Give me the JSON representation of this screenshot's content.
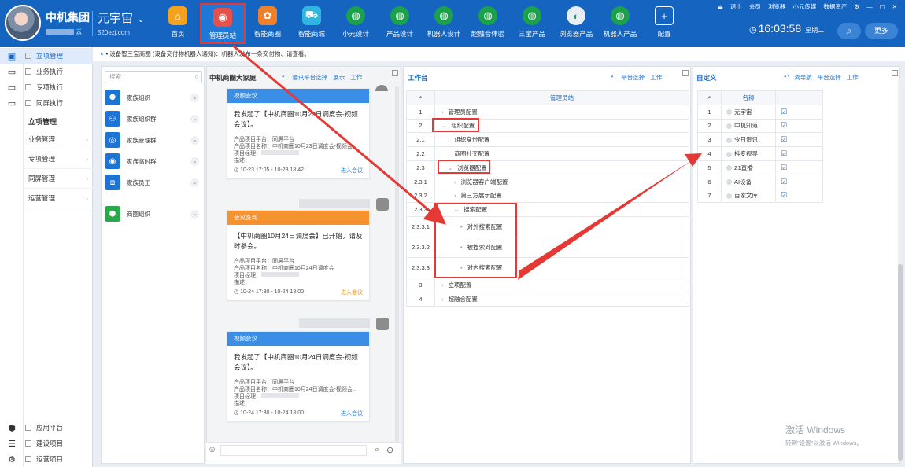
{
  "header": {
    "company": "中机集团",
    "company_sub": "云",
    "universe": "元宇宙",
    "universe_url": "520ezj.com",
    "nav": [
      {
        "label": "首页",
        "icon": "home-icon",
        "color": "#f4a11e",
        "active": false
      },
      {
        "label": "管理员站",
        "icon": "admin-icon",
        "color": "#e8504a",
        "active": true
      },
      {
        "label": "智能商圈",
        "icon": "business-circle-icon",
        "color": "#f0802c",
        "active": false
      },
      {
        "label": "智能商城",
        "icon": "cart-icon",
        "color": "#2fb6e0",
        "active": false
      },
      {
        "label": "小元设计",
        "icon": "globe-icon",
        "color": "#1aa14a",
        "active": false
      },
      {
        "label": "产品设计",
        "icon": "globe-icon",
        "color": "#1aa14a",
        "active": false
      },
      {
        "label": "机器人设计",
        "icon": "globe-icon",
        "color": "#1aa14a",
        "active": false
      },
      {
        "label": "超融合体验",
        "icon": "globe-icon",
        "color": "#1aa14a",
        "active": false
      },
      {
        "label": "三宝产品",
        "icon": "globe-icon",
        "color": "#1aa14a",
        "active": false
      },
      {
        "label": "浏览器产品",
        "icon": "browser-icon",
        "color": "#e7eef7",
        "active": false
      },
      {
        "label": "机器人产品",
        "icon": "globe-icon",
        "color": "#1aa14a",
        "active": false
      },
      {
        "label": "配置",
        "icon": "plus-icon",
        "color": "#1565c0",
        "active": false
      }
    ],
    "top_links": [
      "退出",
      "会员",
      "浏览器",
      "小元传媒",
      "数据资产"
    ],
    "time": "16:03:58",
    "weekday": "星期二",
    "search_icon": "⌕",
    "more": "更多"
  },
  "sidebar": {
    "top_items": [
      "立项管理",
      "业务执行",
      "专项执行",
      "同屏执行"
    ],
    "section": "立项管理",
    "sub_items": [
      "业务管理",
      "专项管理",
      "同屏管理",
      "运营管理"
    ],
    "bottom_items": [
      "应用平台",
      "建设项目",
      "运营项目"
    ]
  },
  "ticker": "• 设备智三宝商圈 (设备交付物机器人通知)：机器人发布一条交付物、请查看。",
  "family": {
    "search_placeholder": "搜索",
    "items": [
      {
        "label": "家族组织",
        "color": "#1e74d2"
      },
      {
        "label": "家族组织群",
        "color": "#1e74d2"
      },
      {
        "label": "家族管理群",
        "color": "#1e74d2"
      },
      {
        "label": "家族临时群",
        "color": "#1e74d2"
      },
      {
        "label": "家族员工",
        "color": "#1e74d2"
      },
      {
        "label": "商圈组织",
        "color": "#2aa84a"
      }
    ]
  },
  "chat": {
    "title": "中机商圈大家庭",
    "links": [
      "通讯平台选择",
      "展示",
      "工作"
    ],
    "cards": [
      {
        "type": "视频会议",
        "color": "#3a8ee6",
        "text": "我发起了【中机商圈10月23日调度会-视频会议】。",
        "platform": "产品项目平台：同屏平台",
        "name": "产品项目名称：中机商圈10月23日调度会-视频会...",
        "manager": "项目经理：",
        "desc": "描述：",
        "time": "10-23 17:05 - 10-23 18:42",
        "action": "进入会议",
        "action_color": "#1e74d2"
      },
      {
        "type": "会议签到",
        "color": "#f59331",
        "text": "【中机商圈10月24日调度会】已开始，请及时参会。",
        "platform": "产品项目平台：同屏平台",
        "name": "产品项目名称：中机商圈10月24日调度会",
        "manager": "项目经理：",
        "desc": "描述：",
        "time": "10-24 17:30 - 10-24 18:00",
        "action": "进入会议",
        "action_color": "#f08c22"
      },
      {
        "type": "视频会议",
        "color": "#3a8ee6",
        "text": "我发起了【中机商圈10月24日调度会-视频会议】。",
        "platform": "产品项目平台：同屏平台",
        "name": "产品项目名称：中机商圈10月24日调度会-视频会...",
        "manager": "项目经理：",
        "desc": "描述：",
        "time": "10-24 17:30 - 10-24 18:00",
        "action": "进入会议",
        "action_color": "#1e74d2"
      }
    ]
  },
  "workbench": {
    "title": "工作台",
    "links": [
      "平台选择",
      "工作"
    ],
    "column": "管理员站",
    "rows": [
      {
        "num": "1",
        "label": "管理员配置",
        "indent": 0,
        "open": false
      },
      {
        "num": "2",
        "label": "组织配置",
        "indent": 0,
        "open": true
      },
      {
        "num": "2.1",
        "label": "组织身份配置",
        "indent": 1,
        "open": false
      },
      {
        "num": "2.2",
        "label": "商圈社交配置",
        "indent": 1,
        "open": false
      },
      {
        "num": "2.3",
        "label": "浏览器配置",
        "indent": 1,
        "open": true
      },
      {
        "num": "2.3.1",
        "label": "浏览器客户端配置",
        "indent": 2,
        "open": false
      },
      {
        "num": "2.3.2",
        "label": "第三方展示配置",
        "indent": 2,
        "open": false
      },
      {
        "num": "2.3.3",
        "label": "搜索配置",
        "indent": 2,
        "open": true
      },
      {
        "num": "2.3.3.1",
        "label": "对外搜索配置",
        "indent": 3,
        "open": false
      },
      {
        "num": "2.3.3.2",
        "label": "被搜索到配置",
        "indent": 3,
        "open": false
      },
      {
        "num": "2.3.3.3",
        "label": "对内搜索配置",
        "indent": 3,
        "open": false
      },
      {
        "num": "3",
        "label": "立项配置",
        "indent": 0,
        "open": false
      },
      {
        "num": "4",
        "label": "超融合配置",
        "indent": 0,
        "open": false
      }
    ]
  },
  "custom": {
    "title": "自定义",
    "links": [
      "浏导航",
      "平台选择",
      "工作"
    ],
    "column": "名称",
    "rows": [
      {
        "num": "1",
        "label": "元宇宙"
      },
      {
        "num": "2",
        "label": "中机知道"
      },
      {
        "num": "3",
        "label": "今日资讯"
      },
      {
        "num": "4",
        "label": "抖变视界"
      },
      {
        "num": "5",
        "label": "Z1直播"
      },
      {
        "num": "6",
        "label": "AI设备"
      },
      {
        "num": "7",
        "label": "百家文库"
      }
    ]
  },
  "activation": {
    "line1": "激活 Windows",
    "line2": "转到\"设置\"以激活 Windows。"
  }
}
